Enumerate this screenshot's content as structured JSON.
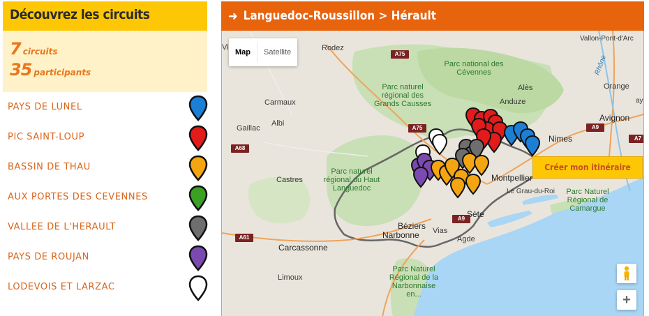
{
  "sidebar": {
    "title": "Découvrez les circuits",
    "stats": {
      "circuits_count": "7",
      "circuits_label": "circuits",
      "participants_count": "35",
      "participants_label": "participants"
    },
    "circuits": [
      {
        "label": "PAYS DE LUNEL",
        "color": "#1b7fd6",
        "icon": "map-pin-icon"
      },
      {
        "label": "PIC SAINT-LOUP",
        "color": "#e31b1b",
        "icon": "map-pin-icon"
      },
      {
        "label": "BASSIN DE THAU",
        "color": "#f5a511",
        "icon": "map-pin-icon"
      },
      {
        "label": "AUX PORTES DES CEVENNES",
        "color": "#3aa125",
        "icon": "map-pin-icon"
      },
      {
        "label": "VALLEE DE L'HERAULT",
        "color": "#6e6e6e",
        "icon": "map-pin-icon"
      },
      {
        "label": "PAYS DE ROUJAN",
        "color": "#7b4ab0",
        "icon": "map-pin-icon"
      },
      {
        "label": "LODEVOIS ET LARZAC",
        "color": "#ffffff",
        "icon": "map-pin-icon"
      }
    ]
  },
  "header": {
    "arrow_icon": "arrow-right-icon",
    "breadcrumb": "Languedoc-Roussillon > Hérault"
  },
  "map": {
    "type_controls": {
      "map": "Map",
      "satellite": "Satellite",
      "active": "Map"
    },
    "cta_label": "Créer mon itinéraire",
    "zoom_in": "+",
    "places": {
      "rodez": "Rodez",
      "carmaux": "Carmaux",
      "albi": "Albi",
      "gaillac": "Gaillac",
      "castres": "Castres",
      "carcassonne": "Carcassonne",
      "narbonne": "Narbonne",
      "beziers": "Béziers",
      "sete": "Sète",
      "agde": "Agde",
      "vias": "Vias",
      "limoux": "Limoux",
      "nimes": "Nimes",
      "avignon": "Avignon",
      "ales": "Alès",
      "anduze": "Anduze",
      "orange": "Orange",
      "vallon": "Vallon-Pont-d'Arc",
      "montpellier": "Montpellier",
      "legrau": "Le Grau-du-Roi",
      "vill": "Vill",
      "ay": "ay"
    },
    "parks": {
      "cevennes": "Parc national des Cévennes",
      "grands_causses": "Parc naturel régional des Grands Causses",
      "haut_languedoc": "Parc naturel régional du Haut Languedoc",
      "camargue": "Parc Naturel Régional de Camargue",
      "narbonnaise": "Parc Naturel Régional de la Narbonnaise en..."
    },
    "roads": [
      "A75",
      "A75",
      "A68",
      "A61",
      "A9",
      "A9",
      "A7"
    ],
    "river": "Rhône",
    "markers": {
      "lunel": {
        "color": "#1b7fd6"
      },
      "pic": {
        "color": "#e31b1b"
      },
      "thau": {
        "color": "#f5a511"
      },
      "herault": {
        "color": "#6e6e6e"
      },
      "roujan": {
        "color": "#7b4ab0"
      },
      "lodevois": {
        "color": "#ffffff"
      }
    }
  }
}
